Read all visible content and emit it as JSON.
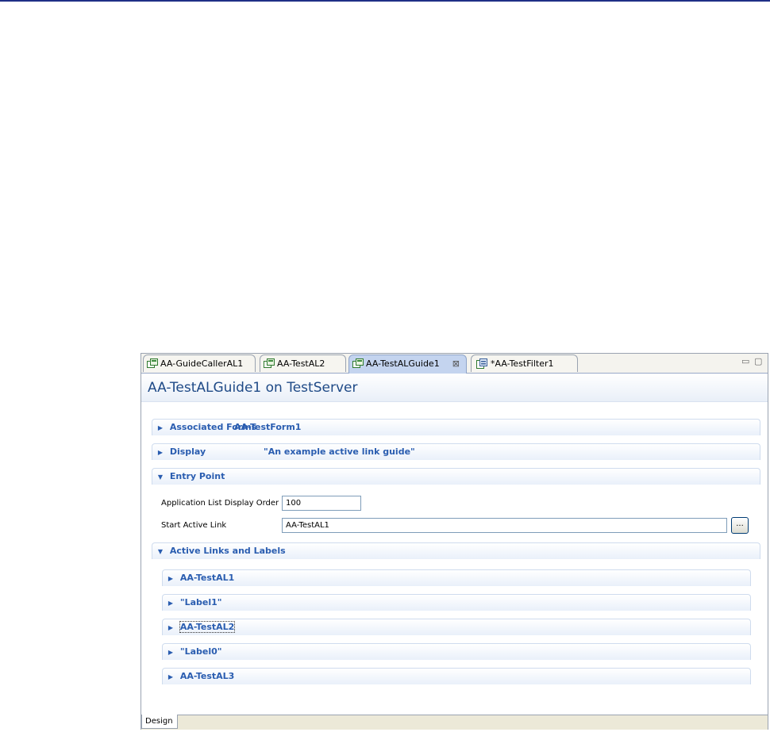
{
  "tabs": [
    {
      "label": "AA-GuideCallerAL1",
      "active": false
    },
    {
      "label": "AA-TestAL2",
      "active": false
    },
    {
      "label": "AA-TestALGuide1",
      "active": true,
      "close_icon": "⊠"
    },
    {
      "label": "*AA-TestFilter1",
      "active": false
    }
  ],
  "window_controls": {
    "minimize": "▭",
    "maximize": "▢"
  },
  "editor_title": "AA-TestALGuide1 on TestServer",
  "sections": {
    "associated_forms": {
      "label": "Associated Forms",
      "value": "AA-TestForm1",
      "expanded": false
    },
    "display": {
      "label": "Display",
      "value": "\"An example active link guide\"",
      "expanded": false
    },
    "entry_point": {
      "label": "Entry Point",
      "expanded": true
    },
    "active_links": {
      "label": "Active Links and Labels",
      "expanded": true
    }
  },
  "entry_point": {
    "order_label": "Application List Display Order",
    "order_value": "100",
    "start_label": "Start Active Link",
    "start_value": "AA-TestAL1",
    "browse_label": "..."
  },
  "active_links": [
    {
      "label": "AA-TestAL1"
    },
    {
      "label": "\"Label1\""
    },
    {
      "label": "AA-TestAL2"
    },
    {
      "label": "\"Label0\""
    },
    {
      "label": "AA-TestAL3"
    }
  ],
  "bottom_tab": "Design",
  "icons": {
    "collapsed": "▶",
    "expanded": "▼"
  },
  "colors": {
    "accent": "#2a5db0",
    "title": "#1f4a87",
    "active_tab": "#c4d4ef"
  }
}
